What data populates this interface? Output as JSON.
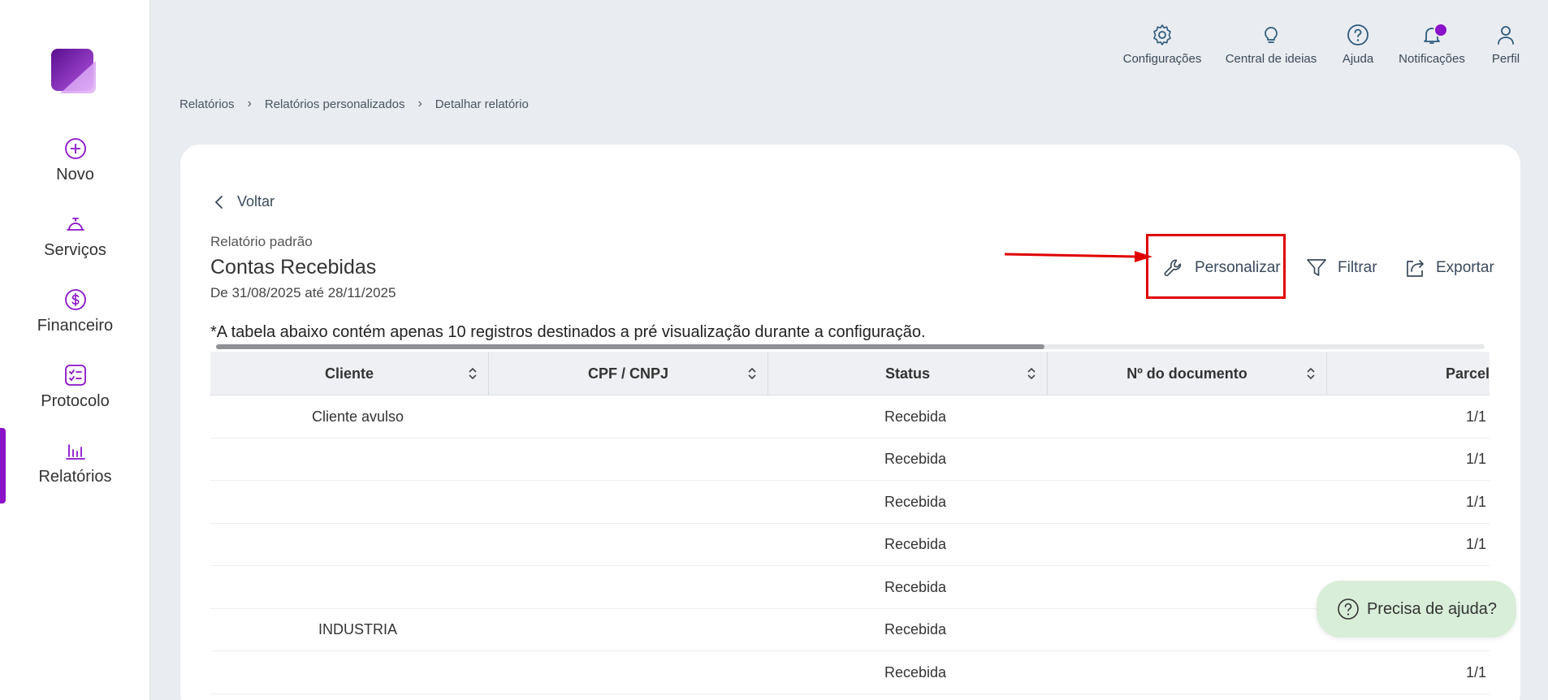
{
  "nav": {
    "items": [
      {
        "label": "Novo",
        "icon": "plus-circle-icon"
      },
      {
        "label": "Serviços",
        "icon": "service-bell-icon"
      },
      {
        "label": "Financeiro",
        "icon": "dollar-circle-icon"
      },
      {
        "label": "Protocolo",
        "icon": "checklist-icon"
      },
      {
        "label": "Relatórios",
        "icon": "bar-chart-icon"
      }
    ],
    "active": "Relatórios"
  },
  "topbar": {
    "settings": "Configurações",
    "ideas": "Central de ideias",
    "help": "Ajuda",
    "notifications": "Notificações",
    "profile": "Perfil"
  },
  "breadcrumb": [
    "Relatórios",
    "Relatórios personalizados",
    "Detalhar relatório"
  ],
  "back_label": "Voltar",
  "report": {
    "kind": "Relatório padrão",
    "title": "Contas Recebidas",
    "range": "De 31/08/2025 até 28/11/2025"
  },
  "actions": {
    "customize": "Personalizar",
    "filter": "Filtrar",
    "export": "Exportar"
  },
  "notice": "*A tabela abaixo contém apenas 10 registros destinados a pré visualização durante a configuração.",
  "table": {
    "columns": [
      "Cliente",
      "CPF / CNPJ",
      "Status",
      "Nº do documento",
      "Parcel"
    ],
    "rows": [
      {
        "cliente": "Cliente avulso",
        "cpf": "",
        "status": "Recebida",
        "doc": "",
        "parcela": "1/1"
      },
      {
        "cliente": "",
        "cpf": "",
        "status": "Recebida",
        "doc": "",
        "parcela": "1/1"
      },
      {
        "cliente": "",
        "cpf": "",
        "status": "Recebida",
        "doc": "",
        "parcela": "1/1"
      },
      {
        "cliente": "",
        "cpf": "",
        "status": "Recebida",
        "doc": "",
        "parcela": "1/1"
      },
      {
        "cliente": "",
        "cpf": "",
        "status": "Recebida",
        "doc": "",
        "parcela": ""
      },
      {
        "cliente": "INDUSTRIA",
        "cpf": "",
        "status": "Recebida",
        "doc": "",
        "parcela": ""
      },
      {
        "cliente": "",
        "cpf": "",
        "status": "Recebida",
        "doc": "",
        "parcela": "1/1"
      }
    ]
  },
  "help_button": "Precisa de ajuda?",
  "colors": {
    "accent": "#8a12c9",
    "highlight": "#e00000",
    "help_bg": "#d8eed8"
  }
}
